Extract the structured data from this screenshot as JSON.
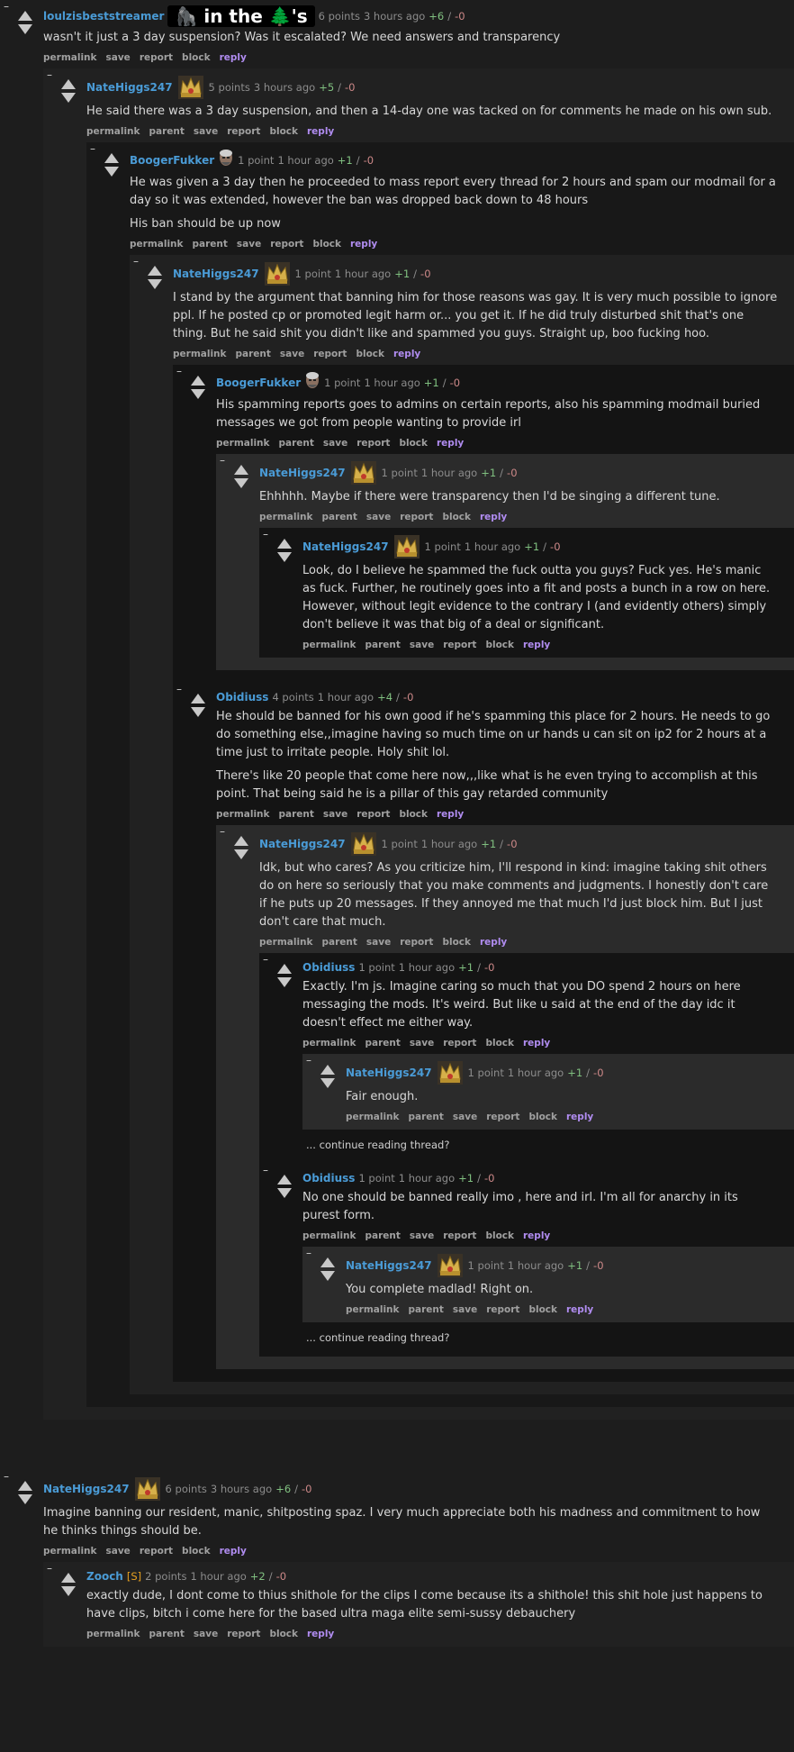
{
  "buttons": {
    "permalink": "permalink",
    "parent": "parent",
    "save": "save",
    "report": "report",
    "block": "block",
    "reply": "reply"
  },
  "continue_label": "... continue reading thread?",
  "collapse_label": "–",
  "comments": {
    "c1": {
      "author": "loulzisbeststreamer",
      "flair_text": "🦍 in the 🌲's",
      "points": "6 points",
      "time": "3 hours ago",
      "up": "+6",
      "down": "-0",
      "body": [
        "wasn't it just a 3 day suspension? Was it escalated? We need answers and transparency"
      ]
    },
    "c2": {
      "author": "NateHiggs247",
      "points": "5 points",
      "time": "3 hours ago",
      "up": "+5",
      "down": "-0",
      "body": [
        "He said there was a 3 day suspension, and then a 14-day one was tacked on for comments he made on his own sub."
      ]
    },
    "c3": {
      "author": "BoogerFukker",
      "points": "1 point",
      "time": "1 hour ago",
      "up": "+1",
      "down": "-0",
      "body": [
        "He was given a 3 day then he proceeded to mass report every thread for 2 hours and spam our modmail for a day so it was extended, however the ban was dropped back down to 48 hours",
        "His ban should be up now"
      ]
    },
    "c4": {
      "author": "NateHiggs247",
      "points": "1 point",
      "time": "1 hour ago",
      "up": "+1",
      "down": "-0",
      "body": [
        "I stand by the argument that banning him for those reasons was gay. It is very much possible to ignore ppl. If he posted cp or promoted legit harm or... you get it. If he did truly disturbed shit that's one thing. But he said shit you didn't like and spammed you guys. Straight up, boo fucking hoo."
      ]
    },
    "c5": {
      "author": "BoogerFukker",
      "points": "1 point",
      "time": "1 hour ago",
      "up": "+1",
      "down": "-0",
      "body": [
        "His spamming reports goes to admins on certain reports, also his spamming modmail buried messages we got from people wanting to provide irl"
      ]
    },
    "c6": {
      "author": "NateHiggs247",
      "points": "1 point",
      "time": "1 hour ago",
      "up": "+1",
      "down": "-0",
      "body": [
        "Ehhhhh. Maybe if there were transparency then I'd be singing a different tune."
      ]
    },
    "c7": {
      "author": "NateHiggs247",
      "points": "1 point",
      "time": "1 hour ago",
      "up": "+1",
      "down": "-0",
      "body": [
        "Look, do I believe he spammed the fuck outta you guys? Fuck yes. He's manic as fuck. Further, he routinely goes into a fit and posts a bunch in a row on here. However, without legit evidence to the contrary I (and evidently others) simply don't believe it was that big of a deal or significant."
      ]
    },
    "c8": {
      "author": "Obidiuss",
      "points": "4 points",
      "time": "1 hour ago",
      "up": "+4",
      "down": "-0",
      "body": [
        "He should be banned for his own good if he's spamming this place for 2 hours. He needs to go do something else,,imagine having so much time on ur hands u can sit on ip2 for 2 hours at a time just to irritate people. Holy shit lol.",
        "There's like 20 people that come here now,,,like what is he even trying to accomplish at this point. That being said he is a pillar of this gay retarded community"
      ]
    },
    "c9": {
      "author": "NateHiggs247",
      "points": "1 point",
      "time": "1 hour ago",
      "up": "+1",
      "down": "-0",
      "body": [
        "Idk, but who cares? As you criticize him, I'll respond in kind: imagine taking shit others do on here so seriously that you make comments and judgments. I honestly don't care if he puts up 20 messages. If they annoyed me that much I'd just block him. But I just don't care that much."
      ]
    },
    "c10": {
      "author": "Obidiuss",
      "points": "1 point",
      "time": "1 hour ago",
      "up": "+1",
      "down": "-0",
      "body": [
        "Exactly. I'm js. Imagine caring so much that you DO spend 2 hours on here messaging the mods. It's weird. But like u said at the end of the day idc it doesn't effect me either way."
      ]
    },
    "c11": {
      "author": "NateHiggs247",
      "points": "1 point",
      "time": "1 hour ago",
      "up": "+1",
      "down": "-0",
      "body": [
        "Fair enough."
      ]
    },
    "c12": {
      "author": "Obidiuss",
      "points": "1 point",
      "time": "1 hour ago",
      "up": "+1",
      "down": "-0",
      "body": [
        "No one should be banned really imo , here and irl. I'm all for anarchy in its purest form."
      ]
    },
    "c13": {
      "author": "NateHiggs247",
      "points": "1 point",
      "time": "1 hour ago",
      "up": "+1",
      "down": "-0",
      "body": [
        "You complete madlad! Right on."
      ]
    },
    "c14": {
      "author": "NateHiggs247",
      "points": "6 points",
      "time": "3 hours ago",
      "up": "+6",
      "down": "-0",
      "body": [
        "Imagine banning our resident, manic, shitposting spaz. I very much appreciate both his madness and commitment to how he thinks things should be."
      ]
    },
    "c15": {
      "author": "Zooch",
      "flag": "[S]",
      "points": "2 points",
      "time": "1 hour ago",
      "up": "+2",
      "down": "-0",
      "body": [
        "exactly dude, I dont come to thius shithole for the clips I come because its a shithole! this shit hole just happens to have clips, bitch i come here for the based ultra maga elite semi-sussy debauchery"
      ]
    }
  }
}
